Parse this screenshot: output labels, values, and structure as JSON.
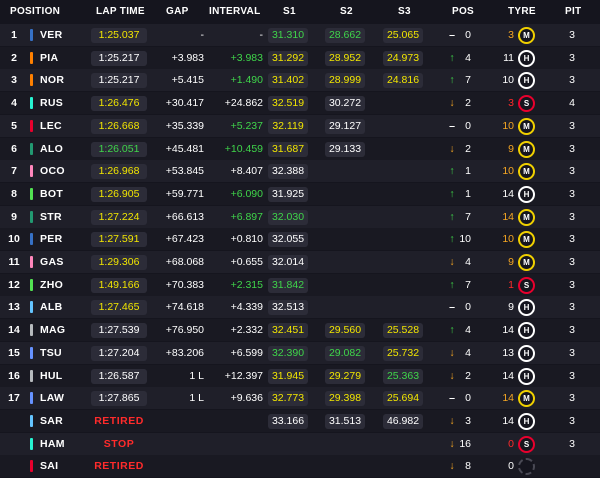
{
  "header": {
    "position": "POSITION",
    "lap_time": "LAP TIME",
    "gap": "GAP",
    "interval": "INTERVAL",
    "s1": "S1",
    "s2": "S2",
    "s3": "S3",
    "pos": "POS",
    "tyre": "TYRE",
    "pit": "PIT"
  },
  "colors": {
    "purple": "#b138dd",
    "green": "#3fd54a",
    "yellow": "#f2e600",
    "white": "#ffffff",
    "red": "#ff2b2b",
    "orange": "#f5a623",
    "tyre_medium": "#f0d000",
    "tyre_hard": "#ffffff",
    "tyre_soft": "#e8002d"
  },
  "rows": [
    {
      "pos": "1",
      "code": "VER",
      "team": "#3671c6",
      "lap": "1:25.037",
      "lap_c": "yellow",
      "lap_pill": true,
      "gap": "-",
      "intv": "-",
      "intv_c": "white",
      "s1": "31.310",
      "s1_c": "green",
      "s2": "28.662",
      "s2_c": "green",
      "s3": "25.065",
      "s3_c": "yellow",
      "arrow": "–",
      "arrow_c": "white",
      "change": "0",
      "age": "3",
      "age_c": "orange",
      "tyre": "M",
      "pit": "3"
    },
    {
      "pos": "2",
      "code": "PIA",
      "team": "#ff8000",
      "lap": "1:25.217",
      "lap_c": "white",
      "lap_pill": true,
      "gap": "+3.983",
      "intv": "+3.983",
      "intv_c": "green",
      "s1": "31.292",
      "s1_c": "yellow",
      "s2": "28.952",
      "s2_c": "yellow",
      "s3": "24.973",
      "s3_c": "yellow",
      "arrow": "↑",
      "arrow_c": "green",
      "change": "4",
      "age": "11",
      "age_c": "white",
      "tyre": "H",
      "pit": "3"
    },
    {
      "pos": "3",
      "code": "NOR",
      "team": "#ff8000",
      "lap": "1:25.217",
      "lap_c": "white",
      "lap_pill": true,
      "gap": "+5.415",
      "intv": "+1.490",
      "intv_c": "green",
      "s1": "31.402",
      "s1_c": "yellow",
      "s2": "28.999",
      "s2_c": "yellow",
      "s3": "24.816",
      "s3_c": "yellow",
      "arrow": "↑",
      "arrow_c": "green",
      "change": "7",
      "age": "10",
      "age_c": "white",
      "tyre": "H",
      "pit": "3"
    },
    {
      "pos": "4",
      "code": "RUS",
      "team": "#27f4d2",
      "lap": "1:26.476",
      "lap_c": "yellow",
      "lap_pill": true,
      "gap": "+30.417",
      "intv": "+24.862",
      "intv_c": "white",
      "s1": "32.519",
      "s1_c": "yellow",
      "s2": "30.272",
      "s2_c": "white",
      "s3": "",
      "s3_c": "white",
      "arrow": "↓",
      "arrow_c": "orange",
      "change": "2",
      "age": "3",
      "age_c": "red",
      "tyre": "S",
      "pit": "4"
    },
    {
      "pos": "5",
      "code": "LEC",
      "team": "#e8002d",
      "lap": "1:26.668",
      "lap_c": "yellow",
      "lap_pill": true,
      "gap": "+35.339",
      "intv": "+5.237",
      "intv_c": "green",
      "s1": "32.119",
      "s1_c": "yellow",
      "s2": "29.127",
      "s2_c": "white",
      "s3": "",
      "s3_c": "white",
      "arrow": "–",
      "arrow_c": "white",
      "change": "0",
      "age": "10",
      "age_c": "orange",
      "tyre": "M",
      "pit": "3"
    },
    {
      "pos": "6",
      "code": "ALO",
      "team": "#229971",
      "lap": "1:26.051",
      "lap_c": "green",
      "lap_pill": true,
      "gap": "+45.481",
      "intv": "+10.459",
      "intv_c": "green",
      "s1": "31.687",
      "s1_c": "yellow",
      "s2": "29.133",
      "s2_c": "white",
      "s3": "",
      "s3_c": "white",
      "arrow": "↓",
      "arrow_c": "orange",
      "change": "2",
      "age": "9",
      "age_c": "orange",
      "tyre": "M",
      "pit": "3"
    },
    {
      "pos": "7",
      "code": "OCO",
      "team": "#ff87bc",
      "lap": "1:26.968",
      "lap_c": "yellow",
      "lap_pill": true,
      "gap": "+53.845",
      "intv": "+8.407",
      "intv_c": "white",
      "s1": "32.388",
      "s1_c": "white",
      "s2": "",
      "s2_c": "white",
      "s3": "",
      "s3_c": "white",
      "arrow": "↑",
      "arrow_c": "green",
      "change": "1",
      "age": "10",
      "age_c": "orange",
      "tyre": "M",
      "pit": "3"
    },
    {
      "pos": "8",
      "code": "BOT",
      "team": "#52e252",
      "lap": "1:26.905",
      "lap_c": "yellow",
      "lap_pill": true,
      "gap": "+59.771",
      "intv": "+6.090",
      "intv_c": "green",
      "s1": "31.925",
      "s1_c": "white",
      "s2": "",
      "s2_c": "white",
      "s3": "",
      "s3_c": "white",
      "arrow": "↑",
      "arrow_c": "green",
      "change": "1",
      "age": "14",
      "age_c": "white",
      "tyre": "H",
      "pit": "3"
    },
    {
      "pos": "9",
      "code": "STR",
      "team": "#229971",
      "lap": "1:27.224",
      "lap_c": "yellow",
      "lap_pill": true,
      "gap": "+66.613",
      "intv": "+6.897",
      "intv_c": "green",
      "s1": "32.030",
      "s1_c": "green",
      "s2": "",
      "s2_c": "white",
      "s3": "",
      "s3_c": "white",
      "arrow": "↑",
      "arrow_c": "green",
      "change": "7",
      "age": "14",
      "age_c": "orange",
      "tyre": "M",
      "pit": "3"
    },
    {
      "pos": "10",
      "code": "PER",
      "team": "#3671c6",
      "lap": "1:27.591",
      "lap_c": "yellow",
      "lap_pill": true,
      "gap": "+67.423",
      "intv": "+0.810",
      "intv_c": "white",
      "s1": "32.055",
      "s1_c": "white",
      "s2": "",
      "s2_c": "white",
      "s3": "",
      "s3_c": "white",
      "arrow": "↑",
      "arrow_c": "green",
      "change": "10",
      "age": "10",
      "age_c": "orange",
      "tyre": "M",
      "pit": "3"
    },
    {
      "pos": "11",
      "code": "GAS",
      "team": "#ff87bc",
      "lap": "1:29.306",
      "lap_c": "yellow",
      "lap_pill": true,
      "gap": "+68.068",
      "intv": "+0.655",
      "intv_c": "white",
      "s1": "32.014",
      "s1_c": "white",
      "s2": "",
      "s2_c": "white",
      "s3": "",
      "s3_c": "white",
      "arrow": "↓",
      "arrow_c": "orange",
      "change": "4",
      "age": "9",
      "age_c": "orange",
      "tyre": "M",
      "pit": "3"
    },
    {
      "pos": "12",
      "code": "ZHO",
      "team": "#52e252",
      "lap": "1:49.166",
      "lap_c": "yellow",
      "lap_pill": true,
      "gap": "+70.383",
      "intv": "+2.315",
      "intv_c": "green",
      "s1": "31.842",
      "s1_c": "green",
      "s2": "",
      "s2_c": "white",
      "s3": "",
      "s3_c": "white",
      "arrow": "↑",
      "arrow_c": "green",
      "change": "7",
      "age": "1",
      "age_c": "red",
      "tyre": "S",
      "pit": "3"
    },
    {
      "pos": "13",
      "code": "ALB",
      "team": "#64c4ff",
      "lap": "1:27.465",
      "lap_c": "yellow",
      "lap_pill": true,
      "gap": "+74.618",
      "intv": "+4.339",
      "intv_c": "white",
      "s1": "32.513",
      "s1_c": "white",
      "s2": "",
      "s2_c": "white",
      "s3": "",
      "s3_c": "white",
      "arrow": "–",
      "arrow_c": "white",
      "change": "0",
      "age": "9",
      "age_c": "white",
      "tyre": "H",
      "pit": "3"
    },
    {
      "pos": "14",
      "code": "MAG",
      "team": "#b6babd",
      "lap": "1:27.539",
      "lap_c": "white",
      "lap_pill": true,
      "gap": "+76.950",
      "intv": "+2.332",
      "intv_c": "white",
      "s1": "32.451",
      "s1_c": "yellow",
      "s2": "29.560",
      "s2_c": "yellow",
      "s3": "25.528",
      "s3_c": "yellow",
      "arrow": "↑",
      "arrow_c": "green",
      "change": "4",
      "age": "14",
      "age_c": "white",
      "tyre": "H",
      "pit": "3"
    },
    {
      "pos": "15",
      "code": "TSU",
      "team": "#6692ff",
      "lap": "1:27.204",
      "lap_c": "white",
      "lap_pill": true,
      "gap": "+83.206",
      "intv": "+6.599",
      "intv_c": "white",
      "s1": "32.390",
      "s1_c": "green",
      "s2": "29.082",
      "s2_c": "green",
      "s3": "25.732",
      "s3_c": "yellow",
      "arrow": "↓",
      "arrow_c": "orange",
      "change": "4",
      "age": "13",
      "age_c": "white",
      "tyre": "H",
      "pit": "3"
    },
    {
      "pos": "16",
      "code": "HUL",
      "team": "#b6babd",
      "lap": "1:26.587",
      "lap_c": "white",
      "lap_pill": true,
      "gap": "1 L",
      "intv": "+12.397",
      "intv_c": "white",
      "s1": "31.945",
      "s1_c": "yellow",
      "s2": "29.279",
      "s2_c": "yellow",
      "s3": "25.363",
      "s3_c": "green",
      "arrow": "↓",
      "arrow_c": "orange",
      "change": "2",
      "age": "14",
      "age_c": "white",
      "tyre": "H",
      "pit": "3"
    },
    {
      "pos": "17",
      "code": "LAW",
      "team": "#6692ff",
      "lap": "1:27.865",
      "lap_c": "white",
      "lap_pill": true,
      "gap": "1 L",
      "intv": "+9.636",
      "intv_c": "white",
      "s1": "32.773",
      "s1_c": "yellow",
      "s2": "29.398",
      "s2_c": "yellow",
      "s3": "25.694",
      "s3_c": "yellow",
      "arrow": "–",
      "arrow_c": "white",
      "change": "0",
      "age": "14",
      "age_c": "orange",
      "tyre": "M",
      "pit": "3"
    },
    {
      "pos": "",
      "code": "SAR",
      "team": "#64c4ff",
      "lap": "RETIRED",
      "lap_c": "red",
      "lap_pill": false,
      "gap": "",
      "intv": "",
      "intv_c": "white",
      "s1": "33.166",
      "s1_c": "white",
      "s2": "31.513",
      "s2_c": "white",
      "s3": "46.982",
      "s3_c": "white",
      "arrow": "↓",
      "arrow_c": "orange",
      "change": "3",
      "age": "14",
      "age_c": "white",
      "tyre": "H",
      "pit": "3"
    },
    {
      "pos": "",
      "code": "HAM",
      "team": "#27f4d2",
      "lap": "STOP",
      "lap_c": "red",
      "lap_pill": false,
      "gap": "",
      "intv": "",
      "intv_c": "white",
      "s1": "",
      "s1_c": "white",
      "s2": "",
      "s2_c": "white",
      "s3": "",
      "s3_c": "white",
      "arrow": "↓",
      "arrow_c": "orange",
      "change": "16",
      "age": "0",
      "age_c": "red",
      "tyre": "S",
      "pit": "3"
    },
    {
      "pos": "",
      "code": "SAI",
      "team": "#e8002d",
      "lap": "RETIRED",
      "lap_c": "red",
      "lap_pill": false,
      "gap": "",
      "intv": "",
      "intv_c": "white",
      "s1": "",
      "s1_c": "white",
      "s2": "",
      "s2_c": "white",
      "s3": "",
      "s3_c": "white",
      "arrow": "↓",
      "arrow_c": "orange",
      "change": "8",
      "age": "0",
      "age_c": "white",
      "tyre": "",
      "pit": ""
    }
  ]
}
